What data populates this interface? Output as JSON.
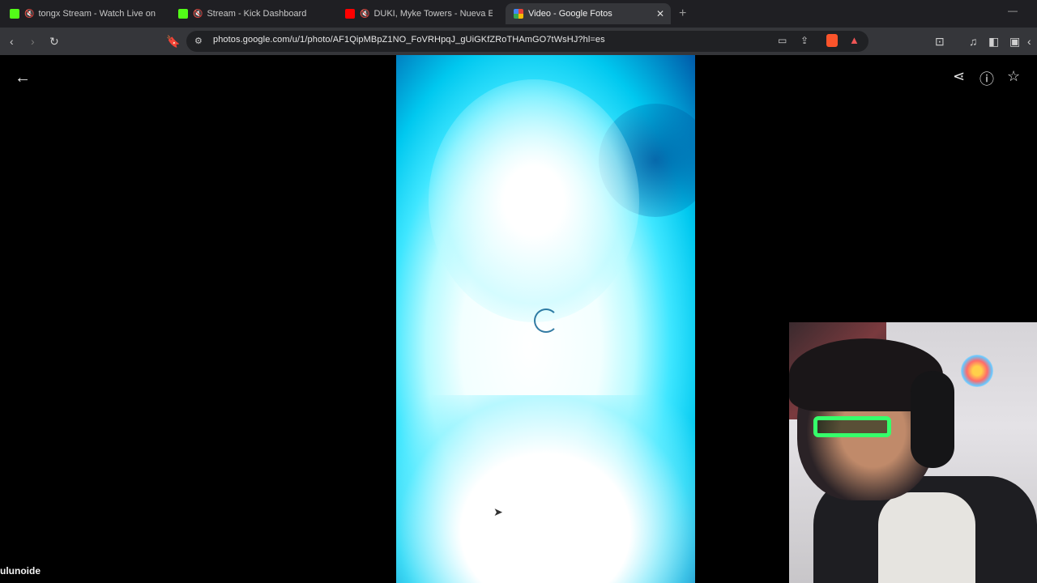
{
  "browser": {
    "tabs": [
      {
        "label": "tongx Stream - Watch Live on Kick",
        "favicon": "kick-icon",
        "muted": true
      },
      {
        "label": "Stream - Kick Dashboard",
        "favicon": "kick-icon",
        "muted": true
      },
      {
        "label": "DUKI, Myke Towers - Nueva Era",
        "favicon": "youtube-icon",
        "muted": true
      },
      {
        "label": "Video - Google Fotos",
        "favicon": "google-photos-icon",
        "active": true
      }
    ],
    "url": "photos.google.com/u/1/photo/AF1QipMBpZ1NO_FoVRHpqJ_gUiGKfZRoTHAmGO7tWsHJ?hl=es"
  },
  "viewer": {
    "loading": true
  },
  "overlay": {
    "streamer_name": "ulunoide"
  },
  "colors": {
    "kick_green": "#53fc18",
    "youtube_red": "#ff0000",
    "brave_orange": "#fb542b"
  }
}
